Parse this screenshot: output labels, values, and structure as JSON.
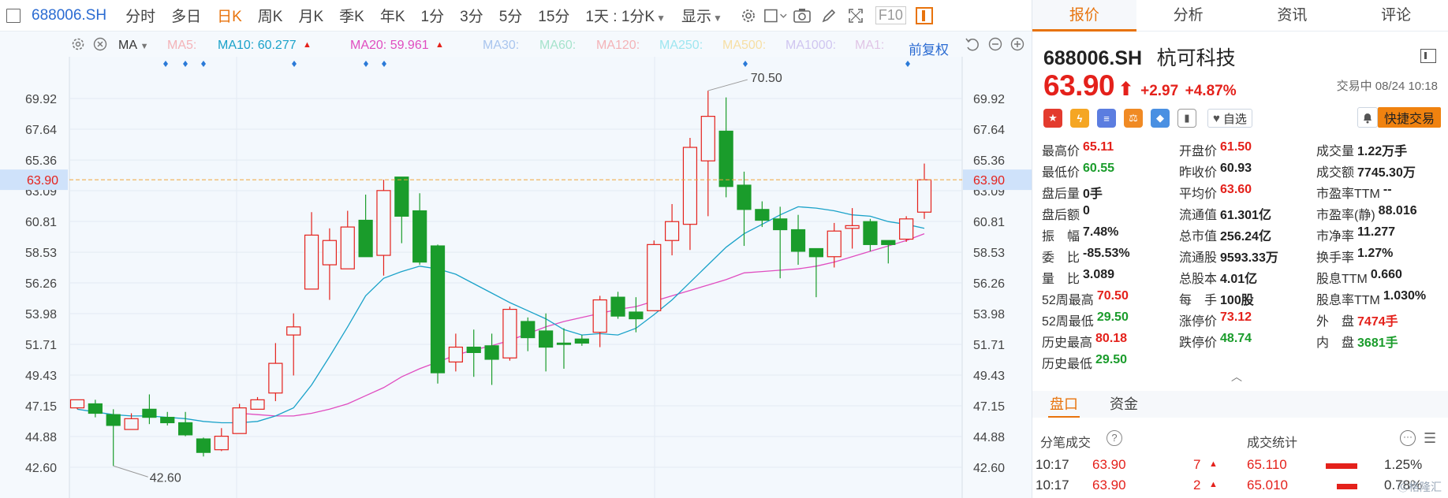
{
  "toolbar": {
    "symbol": "688006.SH",
    "items": [
      {
        "label": "分时",
        "active": false
      },
      {
        "label": "多日",
        "active": false
      },
      {
        "label": "日K",
        "active": true
      },
      {
        "label": "周K",
        "active": false
      },
      {
        "label": "月K",
        "active": false
      },
      {
        "label": "季K",
        "active": false
      },
      {
        "label": "年K",
        "active": false
      },
      {
        "label": "1分",
        "active": false
      },
      {
        "label": "3分",
        "active": false
      },
      {
        "label": "5分",
        "active": false
      },
      {
        "label": "15分",
        "active": false
      }
    ],
    "period_label": "1天 : 1分K",
    "display_label": "显示",
    "f10_label": "F10"
  },
  "ma_bar": {
    "selector_label": "MA",
    "restore_label": "前复权",
    "ma5": {
      "label": "MA5:",
      "color": "#f4b3b8"
    },
    "ma10": {
      "label": "MA10: 60.277",
      "color": "#1aa2c9"
    },
    "ma20": {
      "label": "MA20: 59.961",
      "color": "#e04dc0"
    },
    "ma30": {
      "label": "MA30:",
      "color": "#a9c5ee"
    },
    "ma60": {
      "label": "MA60:",
      "color": "#a6e3cc"
    },
    "ma120": {
      "label": "MA120:",
      "color": "#f4b3b8"
    },
    "ma250": {
      "label": "MA250:",
      "color": "#9ee6f0"
    },
    "ma500": {
      "label": "MA500:",
      "color": "#f6dfa4"
    },
    "ma1000": {
      "label": "MA1000:",
      "color": "#cfc5f0"
    },
    "ma1x": {
      "label": "MA1:",
      "color": "#e0c5e6"
    }
  },
  "chart_data": {
    "type": "candlestick",
    "y_ticks": [
      "69.92",
      "67.64",
      "65.36",
      "63.09",
      "60.81",
      "58.53",
      "56.26",
      "53.98",
      "51.71",
      "49.43",
      "47.15",
      "44.88",
      "42.60"
    ],
    "ylim": [
      41.6,
      71.3
    ],
    "current_price": "63.90",
    "max_label": "70.50",
    "min_label": "42.60",
    "up_color": "#e4211b",
    "down_color": "#1a9c2b",
    "candles": [
      {
        "o": 47.0,
        "c": 47.6,
        "h": 47.6,
        "l": 46.9
      },
      {
        "o": 47.3,
        "c": 46.6,
        "h": 47.6,
        "l": 46.3
      },
      {
        "o": 46.5,
        "c": 45.7,
        "h": 46.9,
        "l": 42.7
      },
      {
        "o": 45.4,
        "c": 46.2,
        "h": 46.6,
        "l": 45.4
      },
      {
        "o": 46.9,
        "c": 46.3,
        "h": 48.0,
        "l": 45.8
      },
      {
        "o": 46.3,
        "c": 45.9,
        "h": 46.7,
        "l": 45.7
      },
      {
        "o": 45.9,
        "c": 45.0,
        "h": 46.7,
        "l": 44.9
      },
      {
        "o": 44.7,
        "c": 43.7,
        "h": 44.8,
        "l": 43.4
      },
      {
        "o": 43.9,
        "c": 44.9,
        "h": 45.5,
        "l": 43.8
      },
      {
        "o": 45.1,
        "c": 47.0,
        "h": 47.3,
        "l": 45.1
      },
      {
        "o": 46.9,
        "c": 47.6,
        "h": 47.8,
        "l": 46.9
      },
      {
        "o": 48.1,
        "c": 50.3,
        "h": 51.8,
        "l": 47.5
      },
      {
        "o": 52.4,
        "c": 53.0,
        "h": 54.0,
        "l": 49.4
      },
      {
        "o": 55.8,
        "c": 59.8,
        "h": 61.5,
        "l": 55.8
      },
      {
        "o": 57.6,
        "c": 59.4,
        "h": 60.3,
        "l": 55.0
      },
      {
        "o": 57.3,
        "c": 60.4,
        "h": 61.6,
        "l": 57.3
      },
      {
        "o": 60.9,
        "c": 58.2,
        "h": 62.8,
        "l": 58.2
      },
      {
        "o": 58.3,
        "c": 63.1,
        "h": 63.9,
        "l": 56.8
      },
      {
        "o": 64.1,
        "c": 61.2,
        "h": 64.1,
        "l": 59.2
      },
      {
        "o": 61.6,
        "c": 57.8,
        "h": 62.9,
        "l": 57.6
      },
      {
        "o": 59.0,
        "c": 49.6,
        "h": 59.1,
        "l": 48.8
      },
      {
        "o": 50.4,
        "c": 51.5,
        "h": 52.5,
        "l": 49.7
      },
      {
        "o": 51.5,
        "c": 51.1,
        "h": 52.8,
        "l": 49.3
      },
      {
        "o": 51.6,
        "c": 50.6,
        "h": 52.5,
        "l": 48.7
      },
      {
        "o": 50.7,
        "c": 54.3,
        "h": 54.5,
        "l": 50.5
      },
      {
        "o": 53.4,
        "c": 52.2,
        "h": 53.7,
        "l": 51.2
      },
      {
        "o": 52.7,
        "c": 51.5,
        "h": 54.0,
        "l": 49.7
      },
      {
        "o": 51.8,
        "c": 51.7,
        "h": 52.9,
        "l": 49.9
      },
      {
        "o": 52.1,
        "c": 51.8,
        "h": 52.4,
        "l": 51.6
      },
      {
        "o": 52.6,
        "c": 55.0,
        "h": 55.3,
        "l": 51.5
      },
      {
        "o": 55.2,
        "c": 53.8,
        "h": 55.6,
        "l": 53.6
      },
      {
        "o": 54.1,
        "c": 53.6,
        "h": 55.2,
        "l": 52.6
      },
      {
        "o": 54.2,
        "c": 59.1,
        "h": 59.4,
        "l": 54.2
      },
      {
        "o": 59.4,
        "c": 60.8,
        "h": 62.1,
        "l": 58.3
      },
      {
        "o": 60.6,
        "c": 66.3,
        "h": 67.0,
        "l": 58.7
      },
      {
        "o": 65.3,
        "c": 68.6,
        "h": 70.5,
        "l": 61.2
      },
      {
        "o": 67.5,
        "c": 63.4,
        "h": 70.0,
        "l": 62.6
      },
      {
        "o": 63.5,
        "c": 61.7,
        "h": 64.5,
        "l": 59.0
      },
      {
        "o": 61.7,
        "c": 60.9,
        "h": 62.3,
        "l": 60.4
      },
      {
        "o": 61.0,
        "c": 60.2,
        "h": 61.9,
        "l": 56.6
      },
      {
        "o": 60.2,
        "c": 58.6,
        "h": 61.3,
        "l": 57.6
      },
      {
        "o": 58.8,
        "c": 58.2,
        "h": 58.8,
        "l": 55.2
      },
      {
        "o": 58.2,
        "c": 60.1,
        "h": 60.7,
        "l": 57.4
      },
      {
        "o": 60.3,
        "c": 60.5,
        "h": 61.8,
        "l": 58.8
      },
      {
        "o": 60.8,
        "c": 59.1,
        "h": 61.0,
        "l": 58.6
      },
      {
        "o": 59.4,
        "c": 59.1,
        "h": 59.4,
        "l": 57.7
      },
      {
        "o": 59.5,
        "c": 61.0,
        "h": 61.2,
        "l": 59.3
      },
      {
        "o": 61.5,
        "c": 63.9,
        "h": 65.1,
        "l": 61.0
      }
    ],
    "ma10_line": [
      46.9,
      46.7,
      46.5,
      46.4,
      46.4,
      46.3,
      46.2,
      46.0,
      45.9,
      45.9,
      46.0,
      46.4,
      47.0,
      48.7,
      50.8,
      53.0,
      55.3,
      56.6,
      57.1,
      57.5,
      57.3,
      56.9,
      56.2,
      55.5,
      54.8,
      54.2,
      53.6,
      52.8,
      52.4,
      52.5,
      52.4,
      52.9,
      53.9,
      55.0,
      56.3,
      57.6,
      58.9,
      59.9,
      60.6,
      61.3,
      61.9,
      61.8,
      61.6,
      61.3,
      61.2,
      60.8,
      60.6,
      60.3
    ],
    "ma20_line": [
      null,
      null,
      null,
      null,
      null,
      null,
      null,
      null,
      null,
      46.6,
      46.5,
      46.4,
      46.4,
      46.6,
      46.9,
      47.3,
      47.9,
      48.5,
      49.3,
      49.9,
      50.4,
      50.9,
      51.3,
      51.6,
      52.0,
      52.5,
      53.0,
      53.4,
      53.7,
      54.0,
      54.3,
      54.5,
      54.9,
      55.3,
      55.7,
      56.1,
      56.5,
      57.0,
      57.1,
      57.2,
      57.3,
      57.5,
      57.8,
      58.2,
      58.6,
      59.0,
      59.4,
      59.9
    ],
    "marker_dots": [
      210,
      235,
      258,
      373,
      464,
      487,
      945,
      1151
    ]
  },
  "right_panel": {
    "tabs": [
      {
        "label": "报价",
        "active": true
      },
      {
        "label": "分析",
        "active": false
      },
      {
        "label": "资讯",
        "active": false
      },
      {
        "label": "评论",
        "active": false
      }
    ],
    "code": "688006.SH",
    "name": "杭可科技",
    "price": "63.90",
    "change": "+2.97",
    "change_pct": "+4.87%",
    "status": "交易中 08/24 10:18",
    "watch_label": "自选",
    "quick_trade_label": "快捷交易",
    "quote_rows": [
      [
        {
          "k": "最高价",
          "v": "65.11",
          "c": "red"
        },
        {
          "k": "开盘价",
          "v": "61.50",
          "c": "red"
        },
        {
          "k": "成交量",
          "v": "1.22万手",
          "c": ""
        }
      ],
      [
        {
          "k": "最低价",
          "v": "60.55",
          "c": "green"
        },
        {
          "k": "昨收价",
          "v": "60.93",
          "c": ""
        },
        {
          "k": "成交额",
          "v": "7745.30万",
          "c": ""
        }
      ],
      [
        {
          "k": "盘后量",
          "v": "0手",
          "c": ""
        },
        {
          "k": "平均价",
          "v": "63.60",
          "c": "red"
        },
        {
          "k": "市盈率TTM",
          "v": "--",
          "c": ""
        }
      ],
      [
        {
          "k": "盘后额",
          "v": "0",
          "c": ""
        },
        {
          "k": "流通值",
          "v": "61.301亿",
          "c": ""
        },
        {
          "k": "市盈率(静)",
          "v": "88.016",
          "c": ""
        }
      ],
      [
        {
          "k": "振　幅",
          "v": "7.48%",
          "c": ""
        },
        {
          "k": "总市值",
          "v": "256.24亿",
          "c": ""
        },
        {
          "k": "市净率",
          "v": "11.277",
          "c": ""
        }
      ],
      [
        {
          "k": "委　比",
          "v": "-85.53%",
          "c": ""
        },
        {
          "k": "流通股",
          "v": "9593.33万",
          "c": ""
        },
        {
          "k": "换手率",
          "v": "1.27%",
          "c": ""
        }
      ],
      [
        {
          "k": "量　比",
          "v": "3.089",
          "c": ""
        },
        {
          "k": "总股本",
          "v": "4.01亿",
          "c": ""
        },
        {
          "k": "股息TTM",
          "v": "0.660",
          "c": ""
        }
      ],
      [
        {
          "k": "52周最高",
          "v": "70.50",
          "c": "red"
        },
        {
          "k": "每　手",
          "v": "100股",
          "c": ""
        },
        {
          "k": "股息率TTM",
          "v": "1.030%",
          "c": ""
        }
      ],
      [
        {
          "k": "52周最低",
          "v": "29.50",
          "c": "green"
        },
        {
          "k": "涨停价",
          "v": "73.12",
          "c": "red"
        },
        {
          "k": "外　盘",
          "v": "7474手",
          "c": "red"
        }
      ],
      [
        {
          "k": "历史最高",
          "v": "80.18",
          "c": "red"
        },
        {
          "k": "跌停价",
          "v": "48.74",
          "c": "green"
        },
        {
          "k": "内　盘",
          "v": "3681手",
          "c": "green"
        }
      ],
      [
        {
          "k": "历史最低",
          "v": "29.50",
          "c": "green"
        },
        {
          "k": "",
          "v": "",
          "c": ""
        },
        {
          "k": "",
          "v": "",
          "c": ""
        }
      ]
    ],
    "sub_tabs": [
      {
        "label": "盘口",
        "active": true
      },
      {
        "label": "资金",
        "active": false
      }
    ],
    "tick_title": "分笔成交",
    "stats_title": "成交统计",
    "ticks": [
      {
        "time": "10:17",
        "price": "63.90",
        "vol": "7",
        "stat_price": "65.110",
        "pct": "1.25%",
        "bar": 1.0
      },
      {
        "time": "10:17",
        "price": "63.90",
        "vol": "2",
        "stat_price": "65.010",
        "pct": "0.78%",
        "bar": 0.65
      }
    ],
    "watermark": "格隆汇"
  }
}
